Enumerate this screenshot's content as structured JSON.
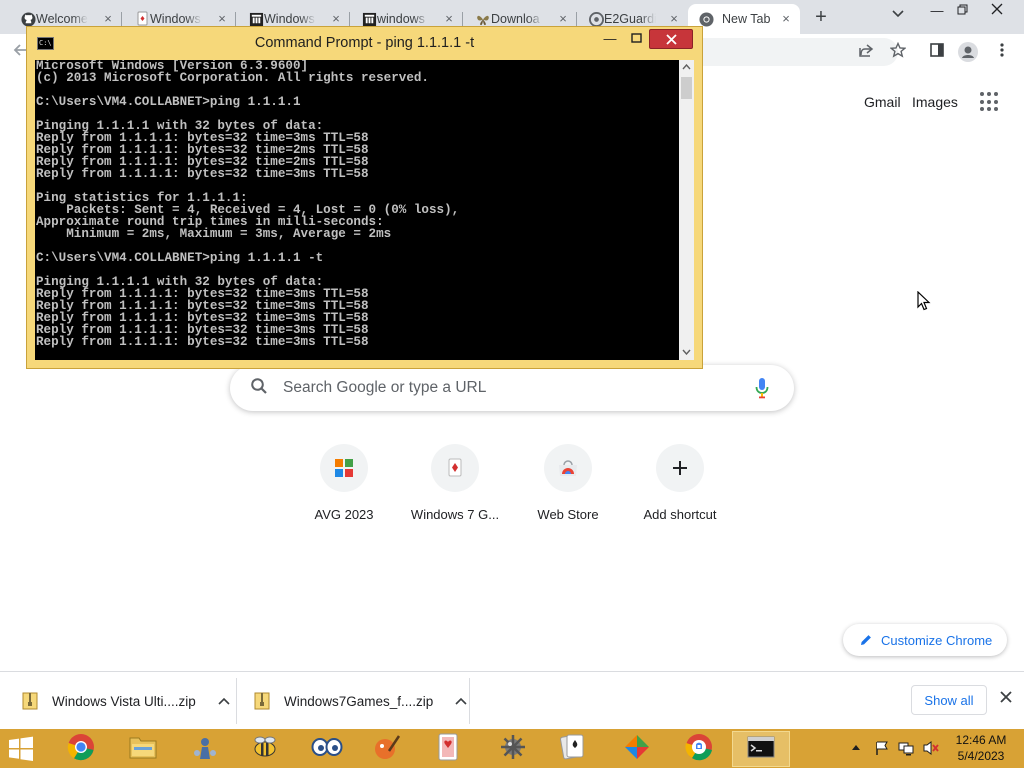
{
  "browser": {
    "tabs": [
      {
        "title": "Welcome",
        "icon": "github-icon"
      },
      {
        "title": "Windows",
        "icon": "cards-icon"
      },
      {
        "title": "Windows",
        "icon": "museum-icon"
      },
      {
        "title": "windows",
        "icon": "museum-icon"
      },
      {
        "title": "Downloa",
        "icon": "butterfly-icon"
      },
      {
        "title": "E2Guardi",
        "icon": "e2-icon"
      },
      {
        "title": "New Tab",
        "icon": "chrome-icon",
        "active": true
      }
    ],
    "new_tab_symbol": "+",
    "close_symbol": "×"
  },
  "ntp": {
    "gmail": "Gmail",
    "images": "Images",
    "search_placeholder": "Search Google or type a URL",
    "shortcuts": [
      {
        "label": "AVG 2023",
        "icon": "avg-icon"
      },
      {
        "label": "Windows 7 G...",
        "icon": "solitaire-icon"
      },
      {
        "label": "Web Store",
        "icon": "web-store-icon"
      },
      {
        "label": "Add shortcut",
        "icon": "plus-icon"
      }
    ],
    "customize": "Customize Chrome"
  },
  "cmd": {
    "title": "Command Prompt - ping  1.1.1.1 -t",
    "lines": [
      "Microsoft Windows [Version 6.3.9600]",
      "(c) 2013 Microsoft Corporation. All rights reserved.",
      "",
      "C:\\Users\\VM4.COLLABNET>ping 1.1.1.1",
      "",
      "Pinging 1.1.1.1 with 32 bytes of data:",
      "Reply from 1.1.1.1: bytes=32 time=3ms TTL=58",
      "Reply from 1.1.1.1: bytes=32 time=2ms TTL=58",
      "Reply from 1.1.1.1: bytes=32 time=2ms TTL=58",
      "Reply from 1.1.1.1: bytes=32 time=3ms TTL=58",
      "",
      "Ping statistics for 1.1.1.1:",
      "    Packets: Sent = 4, Received = 4, Lost = 0 (0% loss),",
      "Approximate round trip times in milli-seconds:",
      "    Minimum = 2ms, Maximum = 3ms, Average = 2ms",
      "",
      "C:\\Users\\VM4.COLLABNET>ping 1.1.1.1 -t",
      "",
      "Pinging 1.1.1.1 with 32 bytes of data:",
      "Reply from 1.1.1.1: bytes=32 time=3ms TTL=58",
      "Reply from 1.1.1.1: bytes=32 time=3ms TTL=58",
      "Reply from 1.1.1.1: bytes=32 time=3ms TTL=58",
      "Reply from 1.1.1.1: bytes=32 time=3ms TTL=58",
      "Reply from 1.1.1.1: bytes=32 time=3ms TTL=58"
    ]
  },
  "downloads": {
    "items": [
      {
        "name": "Windows Vista Ulti....zip"
      },
      {
        "name": "Windows7Games_f....zip"
      }
    ],
    "show_all": "Show all"
  },
  "taskbar": {
    "apps": [
      "chrome-icon",
      "file-explorer-icon",
      "chess-icon",
      "bee-icon",
      "eyes-icon",
      "paint-icon",
      "cards-icon",
      "gear-icon",
      "solitaire-icon",
      "avg-icon",
      "chrome-alt-icon",
      "command-prompt-icon"
    ],
    "time": "12:46 AM",
    "date": "5/4/2023"
  }
}
